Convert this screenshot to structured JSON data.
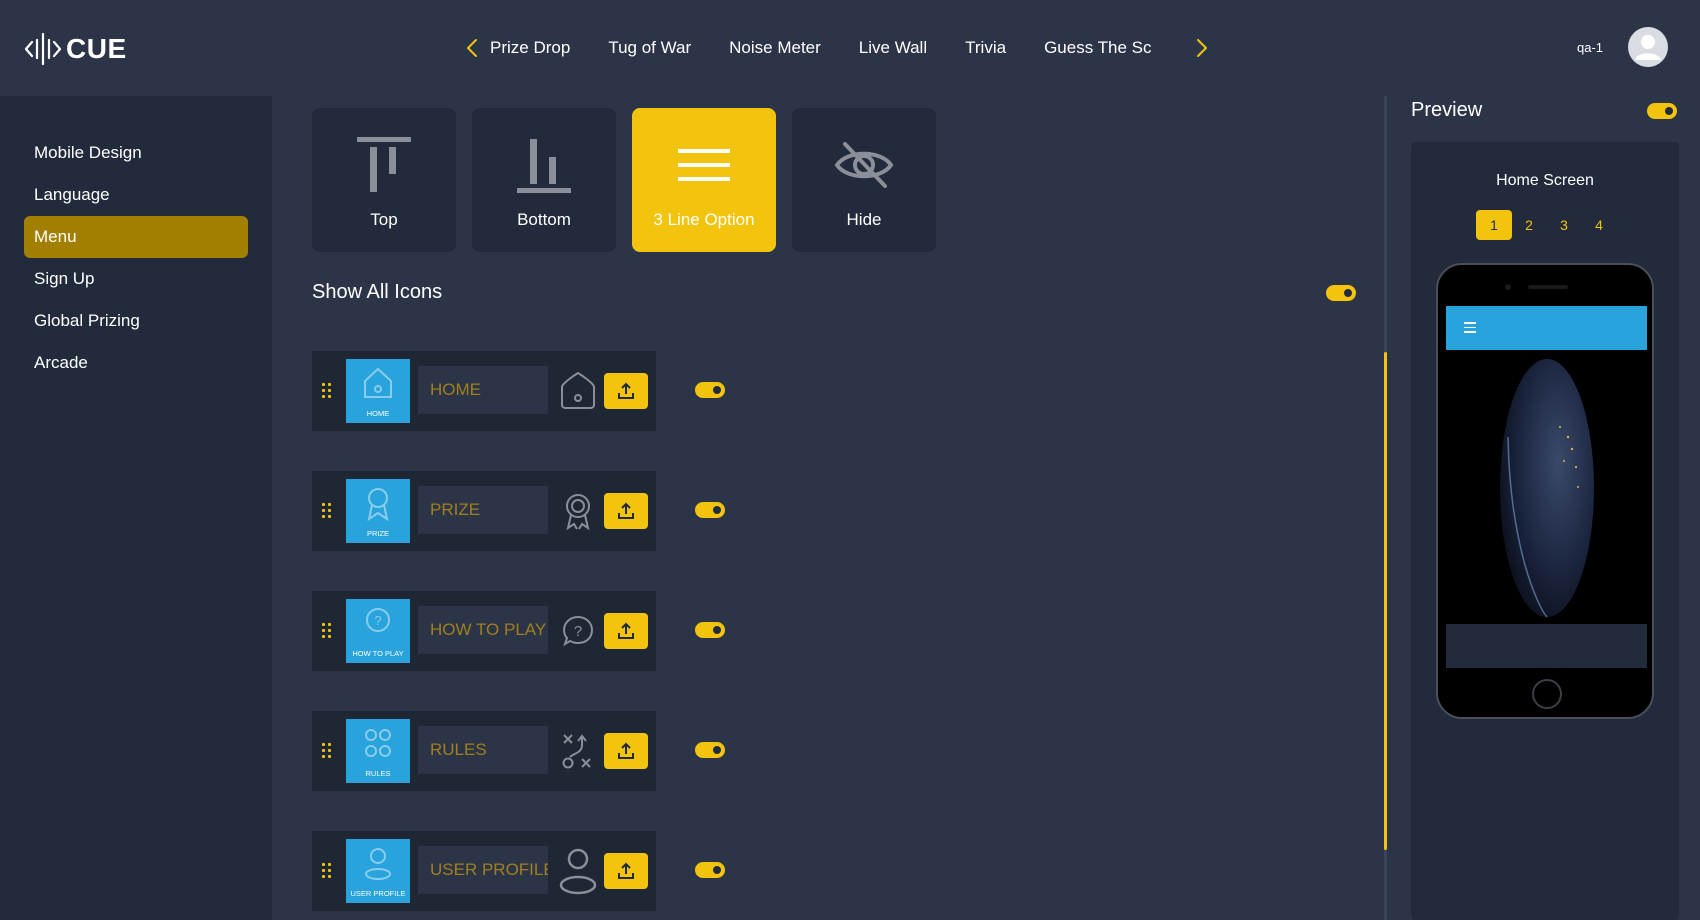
{
  "app": {
    "logo_text": "CUE"
  },
  "nav": {
    "tabs": [
      "Prize Drop",
      "Tug of War",
      "Noise Meter",
      "Live Wall",
      "Trivia",
      "Guess The Sc"
    ]
  },
  "user": {
    "name": "qa-1"
  },
  "sidebar": {
    "items": [
      {
        "label": "Mobile Design",
        "active": false
      },
      {
        "label": "Language",
        "active": false
      },
      {
        "label": "Menu",
        "active": true
      },
      {
        "label": "Sign Up",
        "active": false
      },
      {
        "label": "Global Prizing",
        "active": false
      },
      {
        "label": "Arcade",
        "active": false
      }
    ]
  },
  "menu_position": {
    "options": [
      {
        "label": "Top",
        "icon": "align-top-icon",
        "selected": false
      },
      {
        "label": "Bottom",
        "icon": "align-bottom-icon",
        "selected": false
      },
      {
        "label": "3 Line Option",
        "icon": "hamburger-icon",
        "selected": true
      },
      {
        "label": "Hide",
        "icon": "eye-off-icon",
        "selected": false
      }
    ]
  },
  "show_all_icons": {
    "label": "Show All Icons",
    "enabled": true
  },
  "menu_items": [
    {
      "thumb_label": "HOME",
      "value": "HOME",
      "icon": "home-icon",
      "enabled": true
    },
    {
      "thumb_label": "PRIZE",
      "value": "PRIZE",
      "icon": "award-icon",
      "enabled": true
    },
    {
      "thumb_label": "HOW TO PLAY",
      "value": "HOW TO PLAY",
      "icon": "question-bubble-icon",
      "enabled": true
    },
    {
      "thumb_label": "RULES",
      "value": "RULES",
      "icon": "strategy-icon",
      "enabled": true
    },
    {
      "thumb_label": "USER PROFILE",
      "value": "USER PROFILE",
      "icon": "user-icon",
      "enabled": true
    }
  ],
  "preview": {
    "title": "Preview",
    "enabled": true,
    "screen_title": "Home Screen",
    "pages": [
      "1",
      "2",
      "3",
      "4"
    ],
    "active_page": "1"
  },
  "colors": {
    "accent": "#f2c40d",
    "accent_dark": "#a17f00",
    "background": "#2c3548",
    "panel": "#222b3b",
    "thumb_blue": "#29a3dc"
  }
}
